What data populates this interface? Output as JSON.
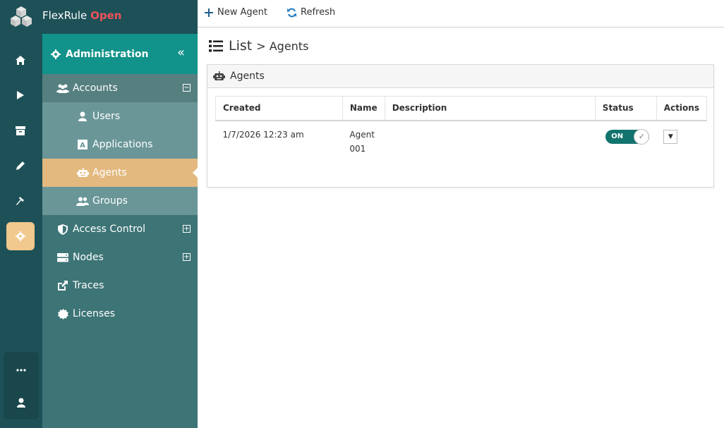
{
  "app": {
    "name": "FlexRule",
    "edition": "Open"
  },
  "rail": {
    "items": [
      {
        "name": "home-icon"
      },
      {
        "name": "play-icon"
      },
      {
        "name": "archive-icon"
      },
      {
        "name": "pencil-icon"
      },
      {
        "name": "hammer-icon"
      },
      {
        "name": "gear-icon",
        "active": true
      }
    ],
    "bottom": [
      {
        "name": "more-icon"
      },
      {
        "name": "user-icon"
      }
    ]
  },
  "sidebar": {
    "section": "Administration",
    "items": [
      {
        "label": "Accounts",
        "expanded": true
      },
      {
        "label": "Users"
      },
      {
        "label": "Applications"
      },
      {
        "label": "Agents",
        "active": true
      },
      {
        "label": "Groups"
      },
      {
        "label": "Access Control",
        "expanded": false
      },
      {
        "label": "Nodes",
        "expanded": false
      },
      {
        "label": "Traces"
      },
      {
        "label": "Licenses"
      }
    ]
  },
  "toolbar": {
    "new_label": "New Agent",
    "refresh_label": "Refresh"
  },
  "breadcrumb": {
    "root": "List",
    "current": "> Agents"
  },
  "panel": {
    "title": "Agents",
    "columns": [
      "Created",
      "Name",
      "Description",
      "Status",
      "Actions"
    ],
    "rows": [
      {
        "created": "1/7/2026 12:23 am",
        "name": "Agent 001",
        "description": "",
        "status": "ON"
      }
    ]
  },
  "colors": {
    "rail": "#1d5157",
    "sidebar": "#3d7476",
    "accent": "#11928a",
    "active": "#e3b97f",
    "brand_highlight": "#f0515a"
  }
}
